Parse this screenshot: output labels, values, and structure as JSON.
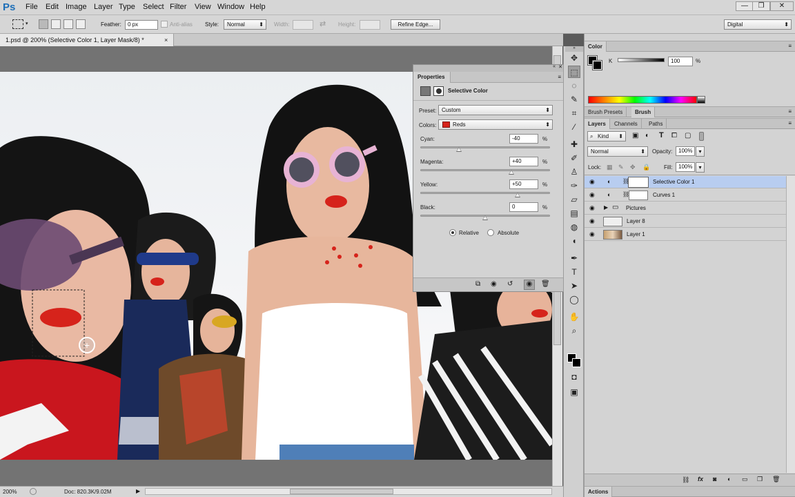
{
  "menubar": {
    "app_logo": "Ps",
    "items": [
      "File",
      "Edit",
      "Image",
      "Layer",
      "Type",
      "Select",
      "Filter",
      "View",
      "Window",
      "Help"
    ],
    "window_controls": {
      "minimize": "—",
      "restore": "❐",
      "close": "✕"
    }
  },
  "options": {
    "feather_label": "Feather:",
    "feather_value": "0 px",
    "antialias_label": "Anti-alias",
    "style_label": "Style:",
    "style_value": "Normal",
    "width_label": "Width:",
    "height_label": "Height:",
    "refine_button": "Refine Edge...",
    "workspace_value": "Digital"
  },
  "document": {
    "tab_title": "1.psd @ 200% (Selective Color 1, Layer Mask/8) *",
    "close": "×"
  },
  "status": {
    "zoom": "200%",
    "doc_info": "Doc: 820.3K/9.02M"
  },
  "properties": {
    "panel_title": "Properties",
    "adjustment_title": "Selective Color",
    "preset_label": "Preset:",
    "preset_value": "Custom",
    "colors_label": "Colors:",
    "colors_value": "Reds",
    "colors_swatch": "#d6231b",
    "sliders": [
      {
        "label": "Cyan:",
        "value": "-40",
        "unit": "%",
        "level": -40
      },
      {
        "label": "Magenta:",
        "value": "+40",
        "unit": "%",
        "level": 40
      },
      {
        "label": "Yellow:",
        "value": "+50",
        "unit": "%",
        "level": 50
      },
      {
        "label": "Black:",
        "value": "0",
        "unit": "%",
        "level": 0
      }
    ],
    "relative_label": "Relative",
    "absolute_label": "Absolute",
    "method_selected": "Relative"
  },
  "color_panel": {
    "tab": "Color",
    "channel_label": "K",
    "value": "100",
    "unit": "%"
  },
  "brush_tabs": [
    "Brush Presets",
    "Brush"
  ],
  "layers_panel": {
    "tabs": [
      "Layers",
      "Channels",
      "Paths"
    ],
    "kind_label": "Kind",
    "blend_mode": "Normal",
    "opacity_label": "Opacity:",
    "opacity_value": "100%",
    "lock_label": "Lock:",
    "fill_label": "Fill:",
    "fill_value": "100%",
    "layers": [
      {
        "name": "Selective Color 1",
        "type": "adjustment",
        "selected": true
      },
      {
        "name": "Curves 1",
        "type": "adjustment",
        "selected": false
      },
      {
        "name": "Pictures",
        "type": "group",
        "selected": false
      },
      {
        "name": "Layer 8",
        "type": "pixel",
        "selected": false
      },
      {
        "name": "Layer 1",
        "type": "image",
        "selected": false
      }
    ]
  },
  "actions_tab": "Actions",
  "colors": {
    "selected_layer": "#b8cdf0",
    "lips_red": "#d6231b"
  }
}
